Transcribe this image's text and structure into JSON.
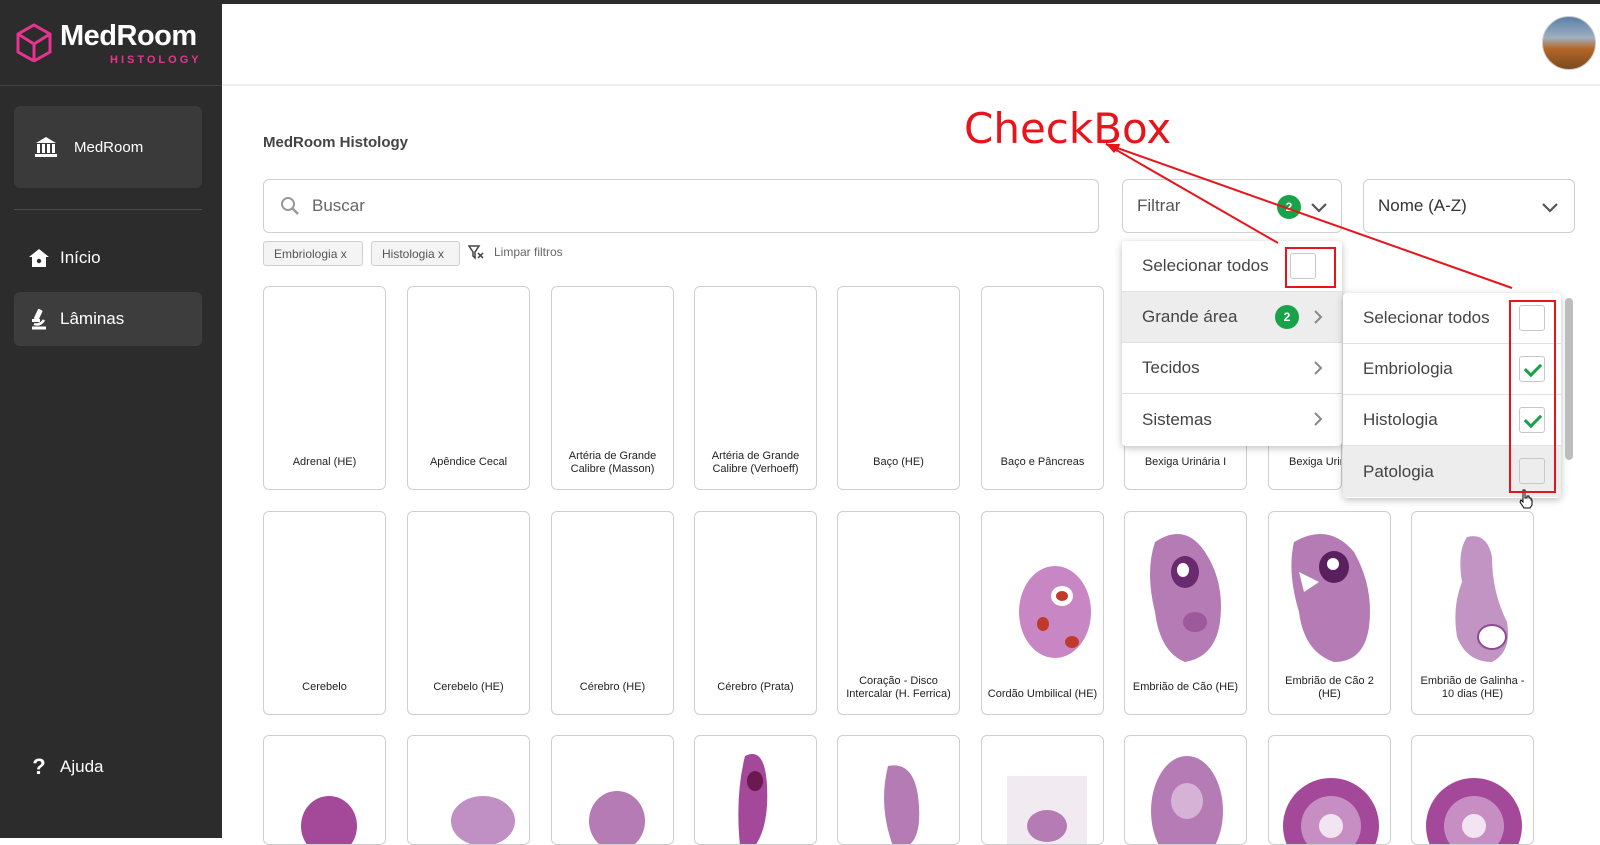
{
  "app": {
    "name": "MedRoom",
    "subtitle": "HISTOLOGY"
  },
  "sidebar": {
    "institution": "MedRoom",
    "nav": [
      {
        "label": "Início",
        "icon": "home-icon"
      },
      {
        "label": "Lâminas",
        "icon": "microscope-icon",
        "active": true
      }
    ],
    "help": "Ajuda"
  },
  "main": {
    "title": "MedRoom Histology",
    "search_placeholder": "Buscar",
    "filter_label": "Filtrar",
    "filter_count": "2",
    "sort_label": "Nome (A-Z)",
    "chips": [
      "Embriologia x",
      "Histologia x"
    ],
    "clear_filters": "Limpar filtros"
  },
  "filter_menu": {
    "select_all": "Selecionar todos",
    "items": [
      {
        "label": "Grande área",
        "count": "2"
      },
      {
        "label": "Tecidos"
      },
      {
        "label": "Sistemas"
      }
    ]
  },
  "submenu": {
    "items": [
      {
        "label": "Selecionar todos",
        "checked": false
      },
      {
        "label": "Embriologia",
        "checked": true
      },
      {
        "label": "Histologia",
        "checked": true
      },
      {
        "label": "Patologia",
        "checked": false
      }
    ]
  },
  "cards_row1": [
    "Adrenal (HE)",
    "Apêndice Cecal",
    "Artéria de Grande Calibre (Masson)",
    "Artéria de Grande Calibre (Verhoeff)",
    "Baço (HE)",
    "Baço e Pâncreas",
    "Bexiga Urinária I",
    "Bexiga Urinária II"
  ],
  "cards_row2": [
    "Cerebelo",
    "Cerebelo (HE)",
    "Cérebro (HE)",
    "Cérebro (Prata)",
    "Coração - Disco Intercalar (H. Ferrica)",
    "Cordão Umbilical (HE)",
    "Embrião de Cão (HE)",
    "Embrião de Cão 2 (HE)",
    "Embrião de Galinha - 10 dias (HE)"
  ],
  "annotation": {
    "label": "CheckBox",
    "color": "#e8141c"
  },
  "colors": {
    "sidebar": "#2c2c2c",
    "accent": "#e8348f",
    "badge": "#1aa24a",
    "stain": "#a4489a"
  }
}
